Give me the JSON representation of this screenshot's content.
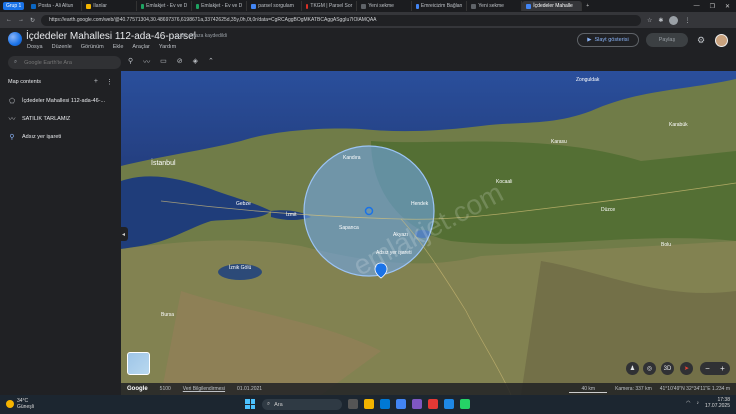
{
  "tabs": {
    "group_label": "Grup 1",
    "items": [
      {
        "label": "Posta - Ali Altun",
        "color": "#0a66c2"
      },
      {
        "label": "Ilanlar",
        "color": "#f2b400"
      },
      {
        "label": "Emlakjet - Ev ve D",
        "color": "#1ea362"
      },
      {
        "label": "Emlakjet - Ev ve D",
        "color": "#1ea362"
      },
      {
        "label": "parsel sorgulam",
        "color": "#4285f4"
      },
      {
        "label": "TKGM | Parsel Sor",
        "color": "#d93025"
      },
      {
        "label": "Yeni sekme",
        "color": "#5f6368"
      },
      {
        "label": "Emreicizim Bağlan",
        "color": "#4285f4"
      },
      {
        "label": "Yeni sekme",
        "color": "#5f6368"
      },
      {
        "label": "İçdedeler Mahalle",
        "color": "#4285f4",
        "active": true
      }
    ],
    "controls": [
      "—",
      "❐",
      "✕"
    ]
  },
  "address": {
    "url": "https://earth.google.com/web/@40.77571304,30.48697376,6198671a,33742625d,35y,0h,0t,0r/data=CgRCAggBOgMKATBCAggASggIu7IOlAMQAA"
  },
  "app": {
    "title": "İçdedeler Mahallesi 112-ada-46-parsel",
    "saved_status": "Bu cihaza kaydedildi",
    "menus": [
      "Dosya",
      "Düzenle",
      "Görünüm",
      "Ekle",
      "Araçlar",
      "Yardım"
    ],
    "slideshow_label": "Slayt gösterisi",
    "share_label": "Paylaş"
  },
  "search": {
    "placeholder": "Google Earth'te Ara"
  },
  "sidebar": {
    "header": "Map contents",
    "items": [
      {
        "label": "İçdedeler Mahallesi 112-ada-46-...",
        "icon": "polygon-icon"
      },
      {
        "label": "SATILIK TARLAMIZ",
        "icon": "path-icon"
      },
      {
        "label": "Adsız yer işareti",
        "icon": "placemark-icon"
      }
    ]
  },
  "map": {
    "place_labels": [
      {
        "text": "Zonguldak"
      },
      {
        "text": "Karabük"
      },
      {
        "text": "İstanbul"
      },
      {
        "text": "Kandıra"
      },
      {
        "text": "Gebze"
      },
      {
        "text": "İzmit"
      },
      {
        "text": "Sapanca"
      },
      {
        "text": "Hendek"
      },
      {
        "text": "Akyazı"
      },
      {
        "text": "Kocaali"
      },
      {
        "text": "Karasu"
      },
      {
        "text": "Düzce"
      },
      {
        "text": "Bolu"
      },
      {
        "text": "Bursa"
      },
      {
        "text": "İznik Gölü"
      },
      {
        "text": "Adsız yer işareti"
      }
    ],
    "watermark": "emlakjet.com"
  },
  "status": {
    "brand": "Google",
    "scale_text": "5100",
    "data_attribution": "Veri Bilgilendirmesi",
    "date": "01.01.2021",
    "scale_bar": "40 km",
    "camera": "Kamera: 337 km",
    "coords": "41°10'49\"N 32°34'11\"E  1.234 m"
  },
  "map_controls": {
    "person": "♟",
    "location": "◎",
    "mode_3d": "3D",
    "compass": "➤",
    "zoom_out": "−",
    "zoom_in": "+"
  },
  "taskbar": {
    "temperature": "34°C",
    "condition": "Güneşli",
    "search_label": "Ara",
    "time": "17:38",
    "date": "17.07.2025"
  }
}
